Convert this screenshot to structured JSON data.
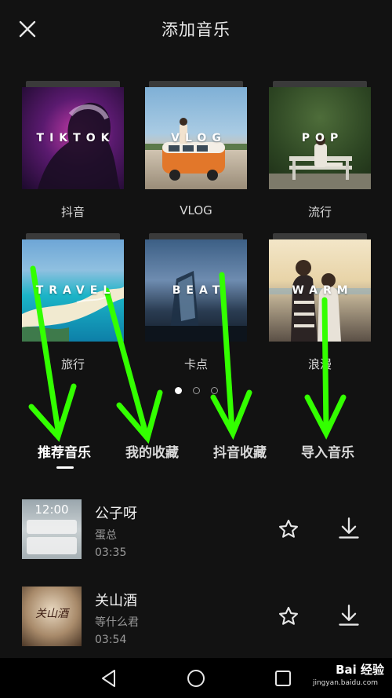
{
  "header": {
    "title": "添加音乐"
  },
  "categories": [
    {
      "overlay": "TIKTOK",
      "label": "抖音"
    },
    {
      "overlay": "VLOG",
      "label": "VLOG"
    },
    {
      "overlay": "POP",
      "label": "流行"
    },
    {
      "overlay": "TRAVEL",
      "label": "旅行"
    },
    {
      "overlay": "BEAT",
      "label": "卡点"
    },
    {
      "overlay": "WARM",
      "label": "浪漫"
    }
  ],
  "pager": {
    "pages": 3,
    "current": 1
  },
  "tabs": [
    {
      "label": "推荐音乐"
    },
    {
      "label": "我的收藏"
    },
    {
      "label": "抖音收藏"
    },
    {
      "label": "导入音乐"
    }
  ],
  "songs": [
    {
      "name": "公子呀",
      "artist": "蛋总",
      "duration": "03:35",
      "thumb_text": "12:00"
    },
    {
      "name": "关山酒",
      "artist": "等什么君",
      "duration": "03:54",
      "thumb_text": "关山酒"
    }
  ],
  "watermark": {
    "brand": "Bai 经验",
    "url": "jingyan.baidu.com"
  },
  "colors": {
    "background": "#121212",
    "annotation_arrow": "#33ff00"
  }
}
